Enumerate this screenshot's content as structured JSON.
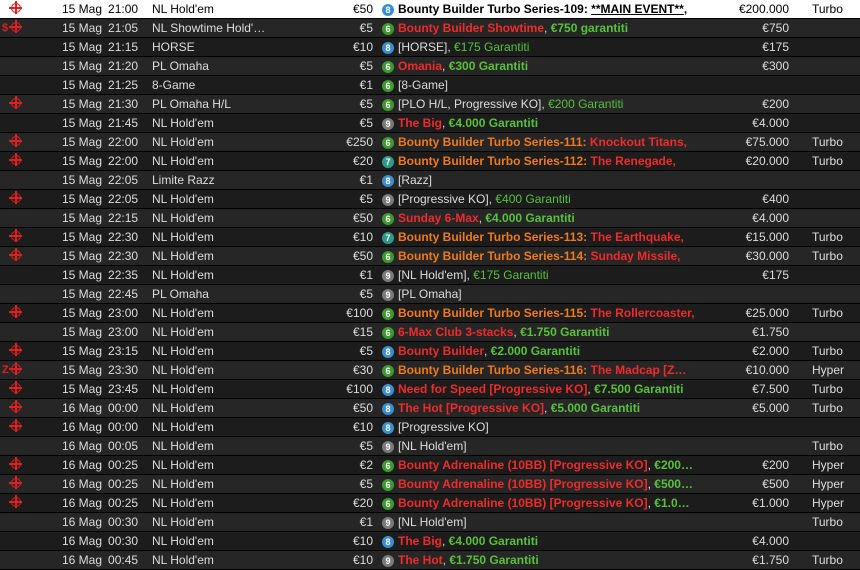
{
  "rows": [
    {
      "flag": "target",
      "pre": "",
      "date": "15 Mag",
      "time": "21:00",
      "game": "NL Hold'em",
      "buyin": "€50",
      "badge": "8",
      "prize": "€200.000",
      "speed": "Turbo",
      "selected": true,
      "name": [
        {
          "t": "Bounty Builder Turbo Series-109:  ",
          "s": "black"
        },
        {
          "t": "**MAIN EVENT**",
          "s": "blacku"
        },
        {
          "t": ",",
          "s": "black"
        }
      ]
    },
    {
      "flag": "target",
      "pre": "$",
      "date": "15 Mag",
      "time": "21:05",
      "game": "NL Showtime Hold'…",
      "buyin": "€5",
      "badge": "6",
      "prize": "€750",
      "speed": "",
      "name": [
        {
          "t": "Bounty Builder Showtime",
          "s": "red"
        },
        {
          "t": ", ",
          "s": "plain"
        },
        {
          "t": "€750 garantiti",
          "s": "greenb"
        }
      ]
    },
    {
      "flag": "",
      "pre": "",
      "date": "15 Mag",
      "time": "21:15",
      "game": "HORSE",
      "buyin": "€10",
      "badge": "8",
      "prize": "€175",
      "speed": "",
      "name": [
        {
          "t": "[HORSE], ",
          "s": "plain"
        },
        {
          "t": "€175 Garantiti",
          "s": "green"
        }
      ]
    },
    {
      "flag": "",
      "pre": "",
      "date": "15 Mag",
      "time": "21:20",
      "game": "PL Omaha",
      "buyin": "€5",
      "badge": "6",
      "prize": "€300",
      "speed": "",
      "name": [
        {
          "t": "Omania",
          "s": "red"
        },
        {
          "t": ", ",
          "s": "plain"
        },
        {
          "t": "€300 Garantiti",
          "s": "greenb"
        }
      ]
    },
    {
      "flag": "",
      "pre": "",
      "date": "15 Mag",
      "time": "21:25",
      "game": "8-Game",
      "buyin": "€1",
      "badge": "6",
      "prize": "",
      "speed": "",
      "name": [
        {
          "t": "[8-Game]",
          "s": "plain"
        }
      ]
    },
    {
      "flag": "target",
      "pre": "",
      "date": "15 Mag",
      "time": "21:30",
      "game": "PL Omaha H/L",
      "buyin": "€5",
      "badge": "6",
      "prize": "€200",
      "speed": "",
      "name": [
        {
          "t": "[PLO H/L, Progressive KO], ",
          "s": "plain"
        },
        {
          "t": "€200 Garantiti",
          "s": "green"
        }
      ]
    },
    {
      "flag": "",
      "pre": "",
      "date": "15 Mag",
      "time": "21:45",
      "game": "NL Hold'em",
      "buyin": "€5",
      "badge": "9",
      "prize": "€4.000",
      "speed": "",
      "name": [
        {
          "t": "The Big",
          "s": "red"
        },
        {
          "t": ", ",
          "s": "plain"
        },
        {
          "t": "€4.000 Garantiti",
          "s": "greenb"
        }
      ]
    },
    {
      "flag": "target",
      "pre": "",
      "date": "15 Mag",
      "time": "22:00",
      "game": "NL Hold'em",
      "buyin": "€250",
      "badge": "6",
      "prize": "€75.000",
      "speed": "Turbo",
      "name": [
        {
          "t": "Bounty Builder Turbo Series-111:  ",
          "s": "orange"
        },
        {
          "t": "Knockout Titans,",
          "s": "red"
        }
      ]
    },
    {
      "flag": "target",
      "pre": "",
      "date": "15 Mag",
      "time": "22:00",
      "game": "NL Hold'em",
      "buyin": "€20",
      "badge": "7",
      "prize": "€20.000",
      "speed": "Turbo",
      "name": [
        {
          "t": "Bounty Builder Turbo Series-112:  ",
          "s": "orange"
        },
        {
          "t": "The Renegade,",
          "s": "red"
        }
      ]
    },
    {
      "flag": "",
      "pre": "",
      "date": "15 Mag",
      "time": "22:05",
      "game": "Limite Razz",
      "buyin": "€1",
      "badge": "8",
      "prize": "",
      "speed": "",
      "name": [
        {
          "t": "[Razz]",
          "s": "plain"
        }
      ]
    },
    {
      "flag": "target",
      "pre": "",
      "date": "15 Mag",
      "time": "22:05",
      "game": "NL Hold'em",
      "buyin": "€5",
      "badge": "9",
      "prize": "€400",
      "speed": "",
      "name": [
        {
          "t": "[Progressive KO], ",
          "s": "plain"
        },
        {
          "t": "€400 Garantiti",
          "s": "green"
        }
      ]
    },
    {
      "flag": "",
      "pre": "",
      "date": "15 Mag",
      "time": "22:15",
      "game": "NL Hold'em",
      "buyin": "€50",
      "badge": "6",
      "prize": "€4.000",
      "speed": "",
      "name": [
        {
          "t": "Sunday 6-Max",
          "s": "red"
        },
        {
          "t": ", ",
          "s": "plain"
        },
        {
          "t": "€4.000 Garantiti",
          "s": "greenb"
        }
      ]
    },
    {
      "flag": "target",
      "pre": "",
      "date": "15 Mag",
      "time": "22:30",
      "game": "NL Hold'em",
      "buyin": "€10",
      "badge": "7",
      "prize": "€15.000",
      "speed": "Turbo",
      "name": [
        {
          "t": "Bounty Builder Turbo Series-113:  ",
          "s": "orange"
        },
        {
          "t": "The Earthquake,",
          "s": "red"
        }
      ]
    },
    {
      "flag": "target",
      "pre": "",
      "date": "15 Mag",
      "time": "22:30",
      "game": "NL Hold'em",
      "buyin": "€50",
      "badge": "6",
      "prize": "€30.000",
      "speed": "Turbo",
      "name": [
        {
          "t": "Bounty Builder Turbo Series-114:  ",
          "s": "orange"
        },
        {
          "t": "Sunday Missile,",
          "s": "red"
        }
      ]
    },
    {
      "flag": "",
      "pre": "",
      "date": "15 Mag",
      "time": "22:35",
      "game": "NL Hold'em",
      "buyin": "€1",
      "badge": "9",
      "prize": "€175",
      "speed": "",
      "name": [
        {
          "t": "[NL Hold'em], ",
          "s": "plain"
        },
        {
          "t": "€175 Garantiti",
          "s": "green"
        }
      ]
    },
    {
      "flag": "",
      "pre": "",
      "date": "15 Mag",
      "time": "22:45",
      "game": "PL Omaha",
      "buyin": "€5",
      "badge": "9",
      "prize": "",
      "speed": "",
      "name": [
        {
          "t": "[PL Omaha]",
          "s": "plain"
        }
      ]
    },
    {
      "flag": "target",
      "pre": "",
      "date": "15 Mag",
      "time": "23:00",
      "game": "NL Hold'em",
      "buyin": "€100",
      "badge": "6",
      "prize": "€25.000",
      "speed": "Turbo",
      "name": [
        {
          "t": "Bounty Builder Turbo Series-115:  ",
          "s": "orange"
        },
        {
          "t": "The Rollercoaster,",
          "s": "red"
        }
      ]
    },
    {
      "flag": "",
      "pre": "",
      "date": "15 Mag",
      "time": "23:00",
      "game": "NL Hold'em",
      "buyin": "€15",
      "badge": "6",
      "prize": "€1.750",
      "speed": "",
      "name": [
        {
          "t": "6-Max Club 3-stacks",
          "s": "red"
        },
        {
          "t": ", ",
          "s": "plain"
        },
        {
          "t": "€1.750 Garantiti",
          "s": "greenb"
        }
      ]
    },
    {
      "flag": "target",
      "pre": "",
      "date": "15 Mag",
      "time": "23:15",
      "game": "NL Hold'em",
      "buyin": "€5",
      "badge": "8",
      "prize": "€2.000",
      "speed": "Turbo",
      "name": [
        {
          "t": "Bounty Builder",
          "s": "red"
        },
        {
          "t": ", ",
          "s": "plain"
        },
        {
          "t": "€2.000 Garantiti",
          "s": "greenb"
        }
      ]
    },
    {
      "flag": "target",
      "pre": "Z",
      "date": "15 Mag",
      "time": "23:30",
      "game": "NL Hold'em",
      "buyin": "€30",
      "badge": "6",
      "prize": "€10.000",
      "speed": "Hyper",
      "name": [
        {
          "t": "Bounty Builder Turbo Series-116:  ",
          "s": "orange"
        },
        {
          "t": "The Madcap [Z…",
          "s": "red"
        }
      ]
    },
    {
      "flag": "target",
      "pre": "",
      "date": "15 Mag",
      "time": "23:45",
      "game": "NL Hold'em",
      "buyin": "€100",
      "badge": "8",
      "prize": "€7.500",
      "speed": "Turbo",
      "name": [
        {
          "t": "Need for Speed [Progressive KO]",
          "s": "red"
        },
        {
          "t": ", ",
          "s": "plain"
        },
        {
          "t": "€7.500 Garantiti",
          "s": "greenb"
        }
      ]
    },
    {
      "flag": "target",
      "pre": "",
      "date": "16 Mag",
      "time": "00:00",
      "game": "NL Hold'em",
      "buyin": "€50",
      "badge": "8",
      "prize": "€5.000",
      "speed": "Turbo",
      "name": [
        {
          "t": "The Hot [Progressive KO]",
          "s": "red"
        },
        {
          "t": ", ",
          "s": "plain"
        },
        {
          "t": "€5.000 Garantiti",
          "s": "greenb"
        }
      ]
    },
    {
      "flag": "target",
      "pre": "",
      "date": "16 Mag",
      "time": "00:00",
      "game": "NL Hold'em",
      "buyin": "€10",
      "badge": "8",
      "prize": "",
      "speed": "",
      "name": [
        {
          "t": "[Progressive KO]",
          "s": "plain"
        }
      ]
    },
    {
      "flag": "",
      "pre": "",
      "date": "16 Mag",
      "time": "00:05",
      "game": "NL Hold'em",
      "buyin": "€5",
      "badge": "9",
      "prize": "",
      "speed": "Turbo",
      "name": [
        {
          "t": "[NL Hold'em]",
          "s": "plain"
        }
      ]
    },
    {
      "flag": "target",
      "pre": "",
      "date": "16 Mag",
      "time": "00:25",
      "game": "NL Hold'em",
      "buyin": "€2",
      "badge": "6",
      "prize": "€200",
      "speed": "Hyper",
      "name": [
        {
          "t": "Bounty Adrenaline (10BB) [Progressive KO]",
          "s": "red"
        },
        {
          "t": ", ",
          "s": "plain"
        },
        {
          "t": "€200…",
          "s": "greenb"
        }
      ]
    },
    {
      "flag": "target",
      "pre": "",
      "date": "16 Mag",
      "time": "00:25",
      "game": "NL Hold'em",
      "buyin": "€5",
      "badge": "6",
      "prize": "€500",
      "speed": "Hyper",
      "name": [
        {
          "t": "Bounty Adrenaline (10BB) [Progressive KO]",
          "s": "red"
        },
        {
          "t": ", ",
          "s": "plain"
        },
        {
          "t": "€500…",
          "s": "greenb"
        }
      ]
    },
    {
      "flag": "target",
      "pre": "",
      "date": "16 Mag",
      "time": "00:25",
      "game": "NL Hold'em",
      "buyin": "€20",
      "badge": "6",
      "prize": "€1.000",
      "speed": "Hyper",
      "name": [
        {
          "t": "Bounty Adrenaline (10BB) [Progressive KO]",
          "s": "red"
        },
        {
          "t": ", ",
          "s": "plain"
        },
        {
          "t": "€1.0…",
          "s": "greenb"
        }
      ]
    },
    {
      "flag": "",
      "pre": "",
      "date": "16 Mag",
      "time": "00:30",
      "game": "NL Hold'em",
      "buyin": "€1",
      "badge": "9",
      "prize": "",
      "speed": "Turbo",
      "name": [
        {
          "t": "[NL Hold'em]",
          "s": "plain"
        }
      ]
    },
    {
      "flag": "",
      "pre": "",
      "date": "16 Mag",
      "time": "00:30",
      "game": "NL Hold'em",
      "buyin": "€10",
      "badge": "8",
      "prize": "€4.000",
      "speed": "",
      "name": [
        {
          "t": "The Big",
          "s": "red"
        },
        {
          "t": ", ",
          "s": "plain"
        },
        {
          "t": "€4.000 Garantiti",
          "s": "greenb"
        }
      ]
    },
    {
      "flag": "",
      "pre": "",
      "date": "16 Mag",
      "time": "00:45",
      "game": "NL Hold'em",
      "buyin": "€10",
      "badge": "9",
      "prize": "€1.750",
      "speed": "Turbo",
      "name": [
        {
          "t": "The Hot",
          "s": "red"
        },
        {
          "t": ", ",
          "s": "plain"
        },
        {
          "t": "€1.750 Garantiti",
          "s": "greenb"
        }
      ]
    }
  ]
}
